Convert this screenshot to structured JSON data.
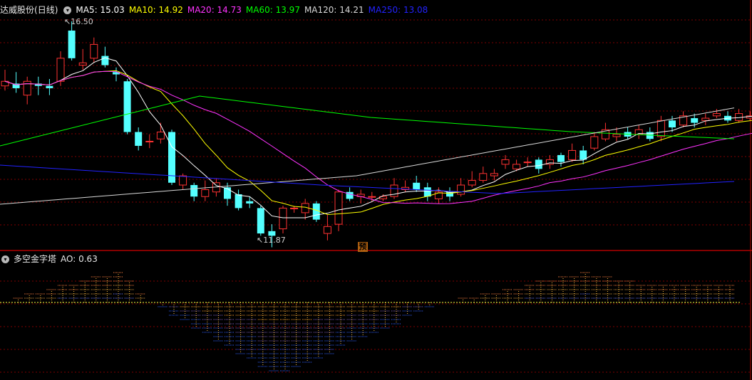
{
  "stock": {
    "name": "达威股份",
    "period": "(日线)"
  },
  "ma": [
    {
      "label": "MA5: 15.03",
      "color": "#ffffff"
    },
    {
      "label": "MA10: 14.92",
      "color": "#ffff00"
    },
    {
      "label": "MA20: 14.73",
      "color": "#ff33ff"
    },
    {
      "label": "MA60: 13.97",
      "color": "#00ff00"
    },
    {
      "label": "MA120: 14.21",
      "color": "#d8d8d8"
    },
    {
      "label": "MA250: 13.08",
      "color": "#2222ff"
    }
  ],
  "menu_icon": "chevron-down-icon",
  "price_high_label": "16.50",
  "price_low_label": "11.87",
  "forecast_marker": "预",
  "indicator": {
    "name": "多空金字塔",
    "value_label": "AO: 0.63"
  },
  "colors": {
    "up": "#ff3232",
    "down": "#54ffff",
    "grid": "#800000"
  },
  "chart_data": {
    "type": "candlestick",
    "series_count": 71,
    "price_high": 16.5,
    "price_low": 11.87
  }
}
